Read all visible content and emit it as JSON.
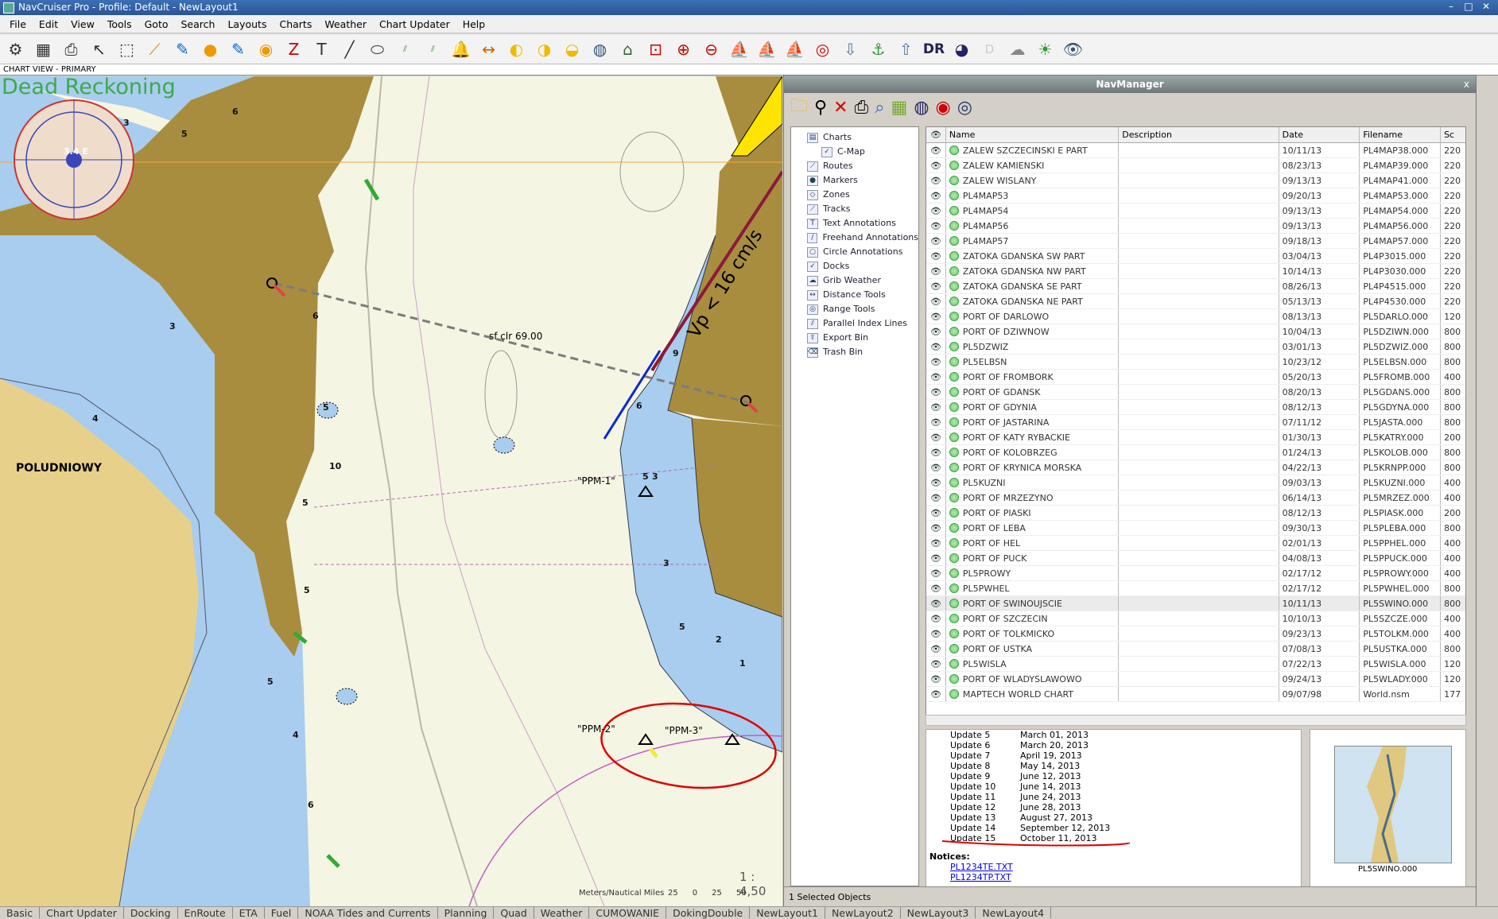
{
  "window": {
    "title": "NavCruiser Pro - Profile: Default - NewLayout1"
  },
  "menu": [
    "File",
    "Edit",
    "View",
    "Tools",
    "Goto",
    "Search",
    "Layouts",
    "Charts",
    "Weather",
    "Chart Updater",
    "Help"
  ],
  "chart_view_label": "CHART VIEW - PRIMARY",
  "chart": {
    "mode_label": "Dead Reckoning",
    "compass_heading": "3.4 E",
    "place_label": "POLUDNIOWY",
    "route_label": "sf clr 69.00",
    "current_label": "Vp < 16 cm/s",
    "ppm1": "\"PPM-1\"",
    "ppm2": "\"PPM-2\"",
    "ppm3": "\"PPM-3\"",
    "scale": "1 : 4,50",
    "scale_units": "Meters/Nautical Miles",
    "scale_ticks": [
      "25",
      "0",
      "25",
      "50"
    ],
    "depths": [
      "6",
      "5",
      "3",
      "3",
      "6",
      "4",
      "5",
      "10",
      "5",
      "5",
      "5",
      "4",
      "6",
      "9",
      "6",
      "5",
      "3",
      "3",
      "5",
      "2",
      "1"
    ]
  },
  "navmanager": {
    "title": "NavManager",
    "close": "x",
    "tree": [
      {
        "label": "Charts",
        "icon": "chart-icon"
      },
      {
        "label": "C-Map",
        "icon": "check-icon"
      },
      {
        "label": "Routes",
        "icon": "route-icon"
      },
      {
        "label": "Markers",
        "icon": "marker-icon"
      },
      {
        "label": "Zones",
        "icon": "zone-icon"
      },
      {
        "label": "Tracks",
        "icon": "track-icon"
      },
      {
        "label": "Text Annotations",
        "icon": "text-icon"
      },
      {
        "label": "Freehand Annotations",
        "icon": "freehand-icon"
      },
      {
        "label": "Circle Annotations",
        "icon": "circle-icon"
      },
      {
        "label": "Docks",
        "icon": "check-icon"
      },
      {
        "label": "Grib Weather",
        "icon": "weather-icon"
      },
      {
        "label": "Distance Tools",
        "icon": "distance-icon"
      },
      {
        "label": "Range Tools",
        "icon": "range-icon"
      },
      {
        "label": "Parallel Index Lines",
        "icon": "parallel-icon"
      },
      {
        "label": "Export Bin",
        "icon": "export-icon"
      },
      {
        "label": "Trash Bin",
        "icon": "trash-icon"
      }
    ],
    "columns": [
      "Name",
      "Description",
      "Date",
      "Filename",
      "Sc"
    ],
    "rows": [
      [
        "ZALEW SZCZECINSKI E PART",
        "10/11/13",
        "PL4MAP38.000",
        "220"
      ],
      [
        "ZALEW KAMIENSKI",
        "08/23/13",
        "PL4MAP39.000",
        "220"
      ],
      [
        "ZALEW WISLANY",
        "09/13/13",
        "PL4MAP41.000",
        "220"
      ],
      [
        "PL4MAP53",
        "09/20/13",
        "PL4MAP53.000",
        "220"
      ],
      [
        "PL4MAP54",
        "09/13/13",
        "PL4MAP54.000",
        "220"
      ],
      [
        "PL4MAP56",
        "09/13/13",
        "PL4MAP56.000",
        "220"
      ],
      [
        "PL4MAP57",
        "09/18/13",
        "PL4MAP57.000",
        "220"
      ],
      [
        "ZATOKA GDANSKA SW PART",
        "03/04/13",
        "PL4P3015.000",
        "220"
      ],
      [
        "ZATOKA GDANSKA NW PART",
        "10/14/13",
        "PL4P3030.000",
        "220"
      ],
      [
        "ZATOKA GDANSKA SE PART",
        "08/26/13",
        "PL4P4515.000",
        "220"
      ],
      [
        "ZATOKA GDANSKA NE PART",
        "05/13/13",
        "PL4P4530.000",
        "220"
      ],
      [
        "PORT OF DARLOWO",
        "08/13/13",
        "PL5DARLO.000",
        "120"
      ],
      [
        "PORT OF DZIWNOW",
        "10/04/13",
        "PL5DZIWN.000",
        "800"
      ],
      [
        "PL5DZWIZ",
        "03/01/13",
        "PL5DZWIZ.000",
        "800"
      ],
      [
        "PL5ELBSN",
        "10/23/12",
        "PL5ELBSN.000",
        "800"
      ],
      [
        "PORT OF FROMBORK",
        "05/20/13",
        "PL5FROMB.000",
        "400"
      ],
      [
        "PORT OF GDANSK",
        "08/20/13",
        "PL5GDANS.000",
        "800"
      ],
      [
        "PORT OF GDYNIA",
        "08/12/13",
        "PL5GDYNA.000",
        "800"
      ],
      [
        "PORT OF JASTARINA",
        "07/11/12",
        "PL5JASTA.000",
        "800"
      ],
      [
        "PORT OF KATY RYBACKIE",
        "01/30/13",
        "PL5KATRY.000",
        "200"
      ],
      [
        "PORT OF KOLOBRZEG",
        "01/24/13",
        "PL5KOLOB.000",
        "800"
      ],
      [
        "PORT OF KRYNICA MORSKA",
        "04/22/13",
        "PL5KRNPP.000",
        "800"
      ],
      [
        "PL5KUZNI",
        "09/03/13",
        "PL5KUZNI.000",
        "400"
      ],
      [
        "PORT OF MRZEZYNO",
        "06/14/13",
        "PL5MRZEZ.000",
        "400"
      ],
      [
        "PORT OF PIASKI",
        "08/12/13",
        "PL5PIASK.000",
        "200"
      ],
      [
        "PORT OF LEBA",
        "09/30/13",
        "PL5PLEBA.000",
        "800"
      ],
      [
        "PORT OF HEL",
        "02/01/13",
        "PL5PPHEL.000",
        "400"
      ],
      [
        "PORT OF PUCK",
        "04/08/13",
        "PL5PPUCK.000",
        "400"
      ],
      [
        "PL5PROWY",
        "02/17/12",
        "PL5PROWY.000",
        "400"
      ],
      [
        "PL5PWHEL",
        "02/17/12",
        "PL5PWHEL.000",
        "800"
      ],
      [
        "PORT OF SWINOUJSCIE",
        "10/11/13",
        "PL5SWINO.000",
        "800"
      ],
      [
        "PORT OF SZCZECIN",
        "10/10/13",
        "PL5SZCZE.000",
        "400"
      ],
      [
        "PORT OF TOLKMICKO",
        "09/23/13",
        "PL5TOLKM.000",
        "400"
      ],
      [
        "PORT OF USTKA",
        "07/08/13",
        "PL5USTKA.000",
        "800"
      ],
      [
        "PL5WISLA",
        "07/22/13",
        "PL5WISLA.000",
        "120"
      ],
      [
        "PORT OF WLADYSLAWOWO",
        "09/24/13",
        "PL5WLADY.000",
        "120"
      ],
      [
        "MAPTECH WORLD CHART",
        "09/07/98",
        "World.nsm",
        "177"
      ]
    ],
    "selected_row": 30,
    "updates": [
      [
        "Update 5",
        "March 01, 2013"
      ],
      [
        "Update 6",
        "March 20, 2013"
      ],
      [
        "Update 7",
        "April 19, 2013"
      ],
      [
        "Update 8",
        "May 14, 2013"
      ],
      [
        "Update 9",
        "June 12, 2013"
      ],
      [
        "Update 10",
        "June 14, 2013"
      ],
      [
        "Update 11",
        "June 24, 2013"
      ],
      [
        "Update 12",
        "June 28, 2013"
      ],
      [
        "Update 13",
        "August 27, 2013"
      ],
      [
        "Update 14",
        "September 12, 2013"
      ],
      [
        "Update 15",
        "October 11, 2013"
      ]
    ],
    "notices_label": "Notices:",
    "notice_links": [
      "PL1234TE.TXT",
      "PL1234TP.TXT"
    ],
    "thumb_caption": "PL5SWINO.000",
    "status": "1 Selected Objects"
  },
  "tabs": [
    "Basic",
    "Chart Updater",
    "Docking",
    "EnRoute",
    "ETA",
    "Fuel",
    "NOAA Tides and Currents",
    "Planning",
    "Quad",
    "Weather",
    "CUMOWANIE",
    "DokingDouble",
    "NewLayout1",
    "NewLayout2",
    "NewLayout3",
    "NewLayout4"
  ],
  "colors": {
    "water": "#a8cdee",
    "land": "#a88d3e",
    "shallow": "#f5f5e3",
    "annotation": "#e00000"
  }
}
